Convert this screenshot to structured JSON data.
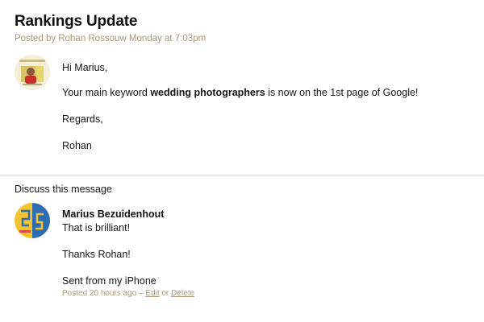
{
  "message": {
    "title": "Rankings Update",
    "posted_by": "Posted by Rohan Rossouw Monday at 7:03pm",
    "greeting": "Hi Marius,",
    "body_prefix": "Your main keyword ",
    "body_keyword": "wedding photographers",
    "body_suffix": " is now on the 1st page of Google!",
    "closing": "Regards,",
    "signature": "Rohan",
    "avatar_icon": "author-photo-icon"
  },
  "discussion": {
    "heading": "Discuss this message",
    "reply": {
      "author": "Marius Bezuidenhout",
      "lines": [
        "That is brilliant!",
        "Thanks Rohan!",
        "Sent from my iPhone"
      ],
      "posted_time": "Posted 20 hours ago",
      "separator": "–",
      "edit_label": "Edit",
      "or_label": "or",
      "delete_label": "Delete",
      "avatar_icon": "yellow-blue-avatar-icon"
    }
  },
  "colors": {
    "meta_text": "#a8987a",
    "divider": "#e2e2e2",
    "avatar_yellow": "#f4c430",
    "avatar_blue": "#2f6db3"
  }
}
